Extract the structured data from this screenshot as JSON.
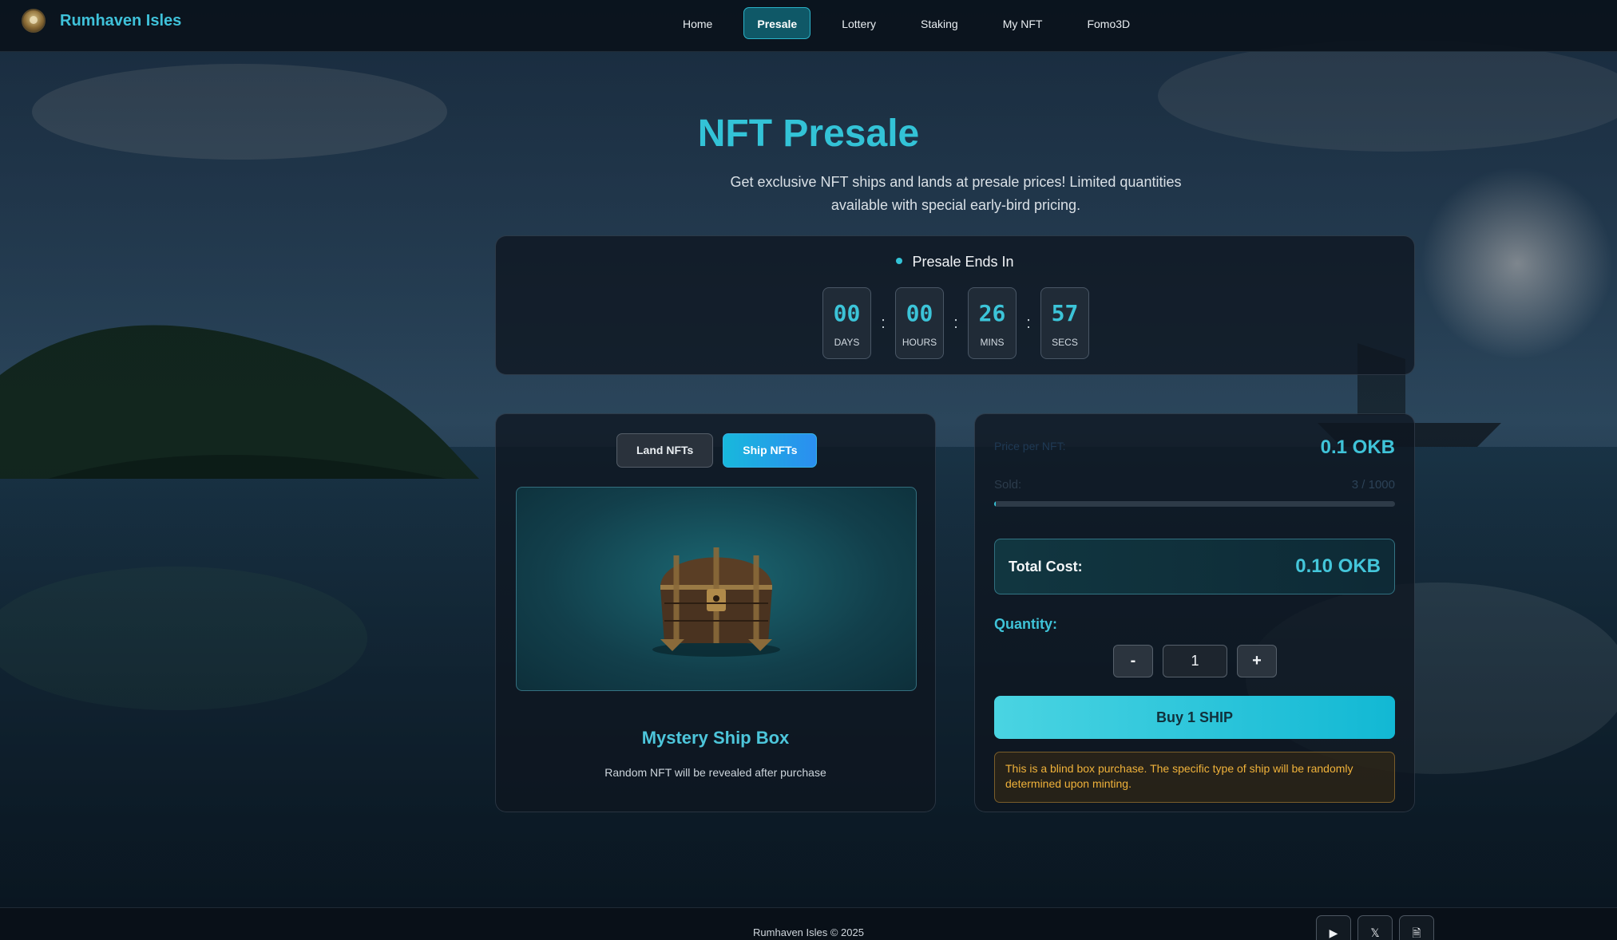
{
  "brand": {
    "name": "Rumhaven Isles",
    "logo_icon": "pirate-emblem-icon"
  },
  "nav": {
    "items": [
      {
        "label": "Home",
        "active": false
      },
      {
        "label": "Presale",
        "active": true
      },
      {
        "label": "Lottery",
        "active": false
      },
      {
        "label": "Staking",
        "active": false
      },
      {
        "label": "My NFT",
        "active": false
      },
      {
        "label": "Fomo3D",
        "active": false
      }
    ]
  },
  "hero": {
    "title": "NFT Presale",
    "subtitle": "Get exclusive NFT ships and lands at presale prices! Limited quantities available with special early-bird pricing."
  },
  "countdown": {
    "label": "Presale Ends In",
    "units": [
      {
        "value": "00",
        "unit": "DAYS"
      },
      {
        "value": "00",
        "unit": "HOURS"
      },
      {
        "value": "26",
        "unit": "MINS"
      },
      {
        "value": "57",
        "unit": "SECS"
      }
    ],
    "separator": ":"
  },
  "nft_panel": {
    "tabs": [
      {
        "label": "Land NFTs",
        "active": false
      },
      {
        "label": "Ship NFTs",
        "active": true
      }
    ],
    "image_icon": "treasure-chest-icon",
    "title": "Mystery Ship Box",
    "description": "Random NFT will be revealed after purchase"
  },
  "purchase_panel": {
    "price_label": "Price per NFT:",
    "price_value": "0.1 OKB",
    "sold_label": "Sold:",
    "sold_value": "3 / 1000",
    "sold_fraction": 0.003,
    "total_label": "Total Cost:",
    "total_value": "0.10 OKB",
    "quantity_label": "Quantity:",
    "decrement_label": "-",
    "quantity_value": "1",
    "increment_label": "+",
    "buy_label": "Buy 1 SHIP",
    "notice": "This is a blind box purchase. The specific type of ship will be randomly determined upon minting."
  },
  "footer": {
    "copyright": "Rumhaven Isles © 2025",
    "socials": [
      {
        "icon": "play-icon",
        "glyph": "▶"
      },
      {
        "icon": "x-twitter-icon",
        "glyph": "𝕏"
      },
      {
        "icon": "document-icon",
        "glyph": "🗎"
      }
    ]
  },
  "colors": {
    "accent": "#33c3d7",
    "active_nav_bg": "#0f5867",
    "active_tab_gradient_start": "#18b8dc",
    "active_tab_gradient_end": "#2b8ef0",
    "buy_gradient_start": "#4ad4e2",
    "buy_gradient_end": "#12b8d4",
    "notice_text": "#f0b23a",
    "notice_border": "#7a5d2a"
  }
}
